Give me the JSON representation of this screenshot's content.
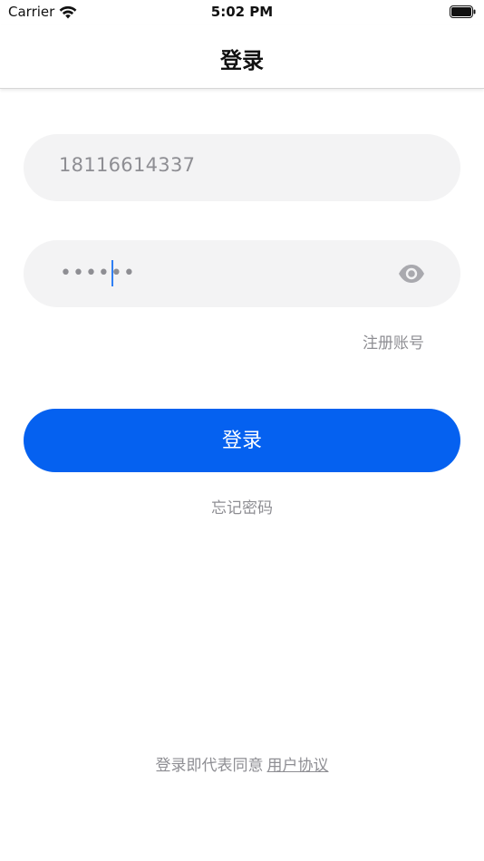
{
  "status_bar": {
    "carrier": "Carrier",
    "time": "5:02 PM"
  },
  "nav": {
    "title": "登录"
  },
  "form": {
    "phone_value": "18116614337",
    "password_masked": "••••••",
    "register_label": "注册账号",
    "login_label": "登录",
    "forgot_label": "忘记密码"
  },
  "footer": {
    "agreement_prefix": "登录即代表同意",
    "agreement_link": "用户协议"
  },
  "icons": {
    "wifi": "wifi-icon",
    "battery": "battery-icon",
    "eye": "eye-icon"
  },
  "colors": {
    "primary": "#0561f0",
    "field_bg": "#f3f3f4",
    "muted_text": "#8e8e93",
    "caret": "#2f7ff4"
  }
}
